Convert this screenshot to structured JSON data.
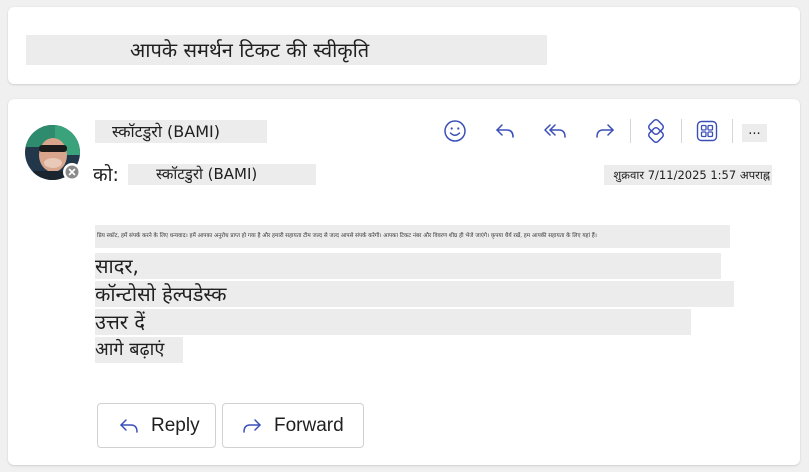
{
  "subject": "आपके समर्थन टिकट की स्वीकृति",
  "message": {
    "sender_name": "स्कॉटडुरो (BAMI)",
    "to_label": "को:",
    "to_name": "स्कॉटडुरो (BAMI)",
    "date": "शुक्रवार 7/11/2025 1:57 अपराह्न",
    "body_text": "प्रिय स्कॉट, हमें संपर्क करने के लिए धन्यवाद। हमें आपका अनुरोध प्राप्त हो गया है और हमारी सहायता टीम जल्द से जल्द आपसे संपर्क करेगी। आपका टिकट नंबर और विवरण शीघ्र ही भेजे जाएंगे। कृपया धैर्य रखें, हम आपकी सहायता के लिए यहां हैं।",
    "signature": {
      "regards": "सादर,",
      "team": "कॉन्टोसो हेल्पडेस्क",
      "reply_link": "उत्तर दें",
      "forward_link": "आगे बढ़ाएं"
    },
    "more_label": "..."
  },
  "toolbar": {
    "icons": [
      "emoji-icon",
      "reply-icon",
      "reply-all-icon",
      "forward-icon",
      "loop-icon",
      "apps-icon",
      "more-icon"
    ]
  },
  "actions": {
    "reply_label": "Reply",
    "forward_label": "Forward"
  },
  "colors": {
    "accent": "#3b4fb8",
    "background": "#f0f0f0",
    "card": "#ffffff",
    "redaction": "#ececec"
  }
}
